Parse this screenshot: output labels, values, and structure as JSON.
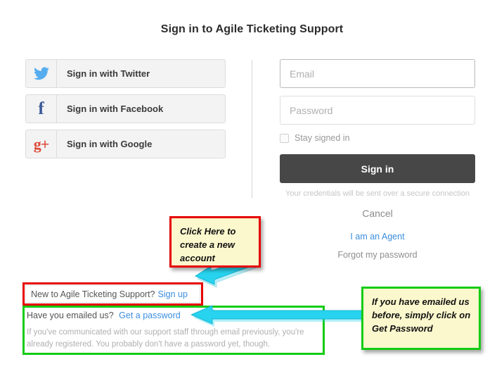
{
  "page": {
    "title": "Sign in to Agile Ticketing Support"
  },
  "social": {
    "buttons": [
      {
        "label": "Sign in with Twitter",
        "icon": "twitter-icon",
        "color": "#55acee"
      },
      {
        "label": "Sign in with Facebook",
        "icon": "facebook-icon",
        "color": "#3b5998",
        "glyph": "f"
      },
      {
        "label": "Sign in with Google",
        "icon": "google-plus-icon",
        "color": "#dd4b39",
        "glyph": "g+"
      }
    ]
  },
  "form": {
    "email": {
      "value": "",
      "placeholder": "Email"
    },
    "password": {
      "value": "",
      "placeholder": "Password"
    },
    "stay_signed_in": {
      "label": "Stay signed in",
      "checked": false
    },
    "signin_label": "Sign in",
    "secure_note": "Your credentials will be sent over a secure connection",
    "cancel_label": "Cancel",
    "agent_label": "I am an Agent",
    "forgot_label": "Forgot my password"
  },
  "footer": {
    "signup_prompt": "New to Agile Ticketing Support?",
    "signup_link": "Sign up",
    "emailed_prompt": "Have you emailed us?",
    "emailed_link": "Get a password",
    "emailed_help": "If you've communicated with our support staff through email previously, you're already registered. You probably don't have a password yet, though."
  },
  "annotations": {
    "note_signup": "Click Here to create a new account",
    "note_password": "If you have emailed us before, simply click on Get Password",
    "highlight_red": "#e60000",
    "highlight_green": "#13cc13",
    "arrow_color": "#27d3ee"
  }
}
